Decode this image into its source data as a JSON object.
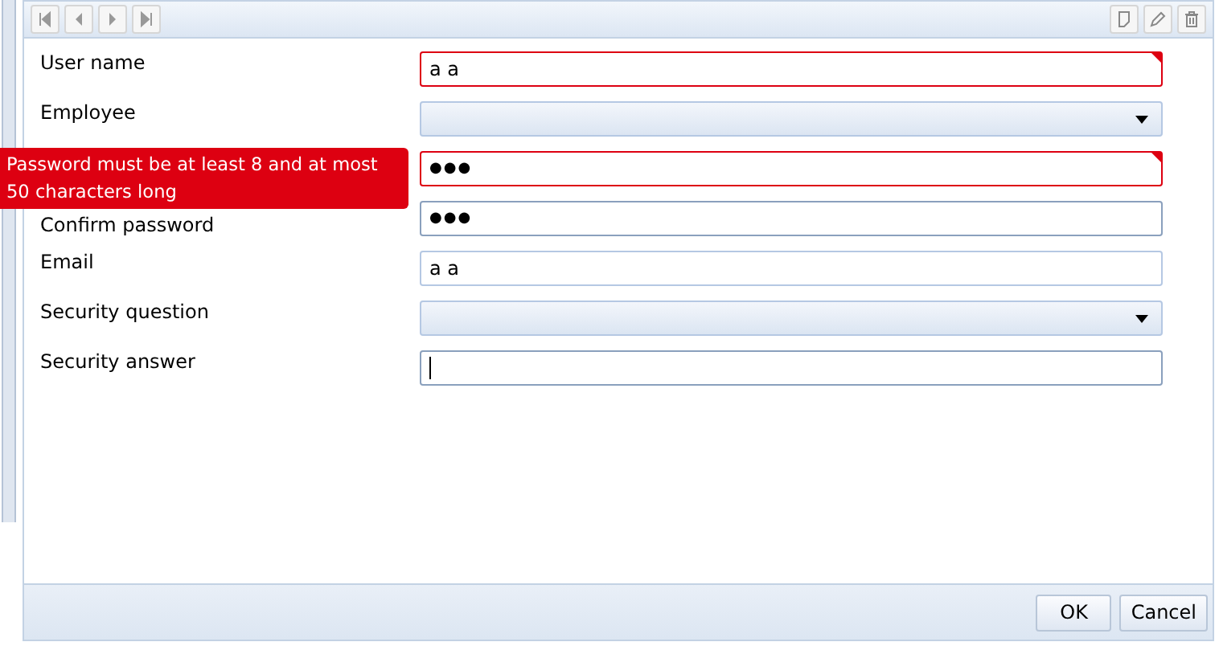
{
  "toolbar": {
    "nav_buttons": [
      {
        "kind": "first"
      },
      {
        "kind": "prev"
      },
      {
        "kind": "next"
      },
      {
        "kind": "last"
      }
    ],
    "action_buttons": [
      {
        "kind": "new"
      },
      {
        "kind": "edit"
      },
      {
        "kind": "delete"
      }
    ]
  },
  "fields": [
    {
      "label": "User name",
      "kind": "text",
      "value": "a a",
      "invalid": true,
      "focused": false
    },
    {
      "label": "Employee",
      "kind": "combo",
      "invalid": false,
      "focused": false
    },
    {
      "kind": "password",
      "value": "●●●",
      "invalid": true,
      "focused": true
    },
    {
      "label": "Confirm password",
      "kind": "password",
      "value": "●●●",
      "invalid": false,
      "focused": true
    },
    {
      "label": "Email",
      "kind": "text",
      "value": "a a",
      "invalid": false,
      "focused": false
    },
    {
      "label": "Security question",
      "kind": "combo",
      "invalid": false,
      "focused": false
    },
    {
      "label": "Security answer",
      "kind": "text",
      "invalid": false,
      "focused": true
    }
  ],
  "error_tooltip": {
    "text": "Password must be at least 8 and at most 50 characters long"
  },
  "buttons": [
    "OK",
    "Cancel"
  ]
}
